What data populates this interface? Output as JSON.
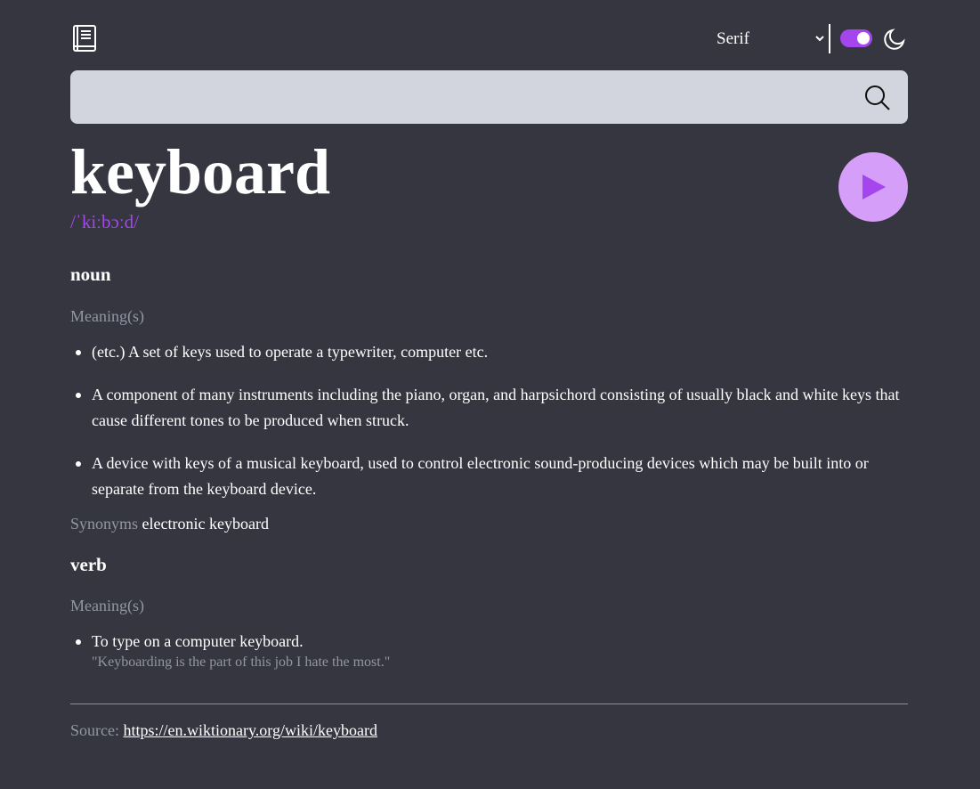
{
  "header": {
    "logo_icon": "book-icon",
    "font_select": {
      "selected": "Serif",
      "icon": "chevron-down-icon"
    },
    "theme_toggle": {
      "state": "on",
      "accent": "#a445ed"
    },
    "theme_icon": "moon-icon"
  },
  "search": {
    "value": "",
    "placeholder": "",
    "icon": "search-icon"
  },
  "entry": {
    "word": "keyboard",
    "phonetic": "/ˈkiːbɔːd/",
    "play_icon": "play-icon",
    "meanings": [
      {
        "part_of_speech": "noun",
        "heading": "Meaning(s)",
        "definitions": [
          {
            "text": "(etc.) A set of keys used to operate a typewriter, computer etc."
          },
          {
            "text": "A component of many instruments including the piano, organ, and harpsichord consisting of usually black and white keys that cause different tones to be produced when struck."
          },
          {
            "text": "A device with keys of a musical keyboard, used to control electronic sound-producing devices which may be built into or separate from the keyboard device."
          }
        ],
        "synonyms_label": "Synonyms",
        "synonyms": "electronic keyboard"
      },
      {
        "part_of_speech": "verb",
        "heading": "Meaning(s)",
        "definitions": [
          {
            "text": "To type on a computer keyboard.",
            "example": "\"Keyboarding is the part of this job I hate the most.\""
          }
        ]
      }
    ]
  },
  "footer": {
    "source_label": "Source:",
    "source_url": "https://en.wiktionary.org/wiki/keyboard"
  },
  "colors": {
    "background": "#363641",
    "accent": "#a445ed",
    "play_button": "#d59ef8",
    "search_bg": "#d2d5dd",
    "muted_text": "#9196a3"
  }
}
